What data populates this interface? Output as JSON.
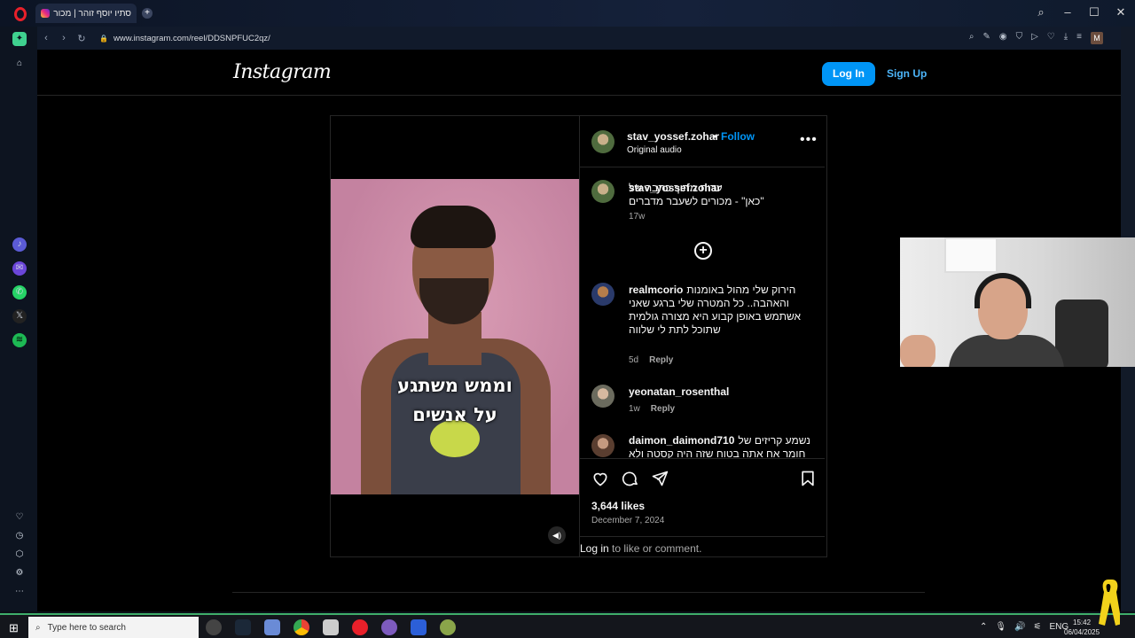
{
  "browser": {
    "tab_title": "סתיו יוסף זוהר | מכורים לשעבר מדברים",
    "url": "www.instagram.com/reel/DDSNPFUC2qz/",
    "profile_initial": "M"
  },
  "instagram": {
    "logo": "Instagram",
    "login_button": "Log In",
    "signup_link": "Sign Up"
  },
  "post": {
    "subtitle_line1": "וממש משתגע",
    "subtitle_line2": "על אנשים",
    "author": {
      "username": "stav_yossef.zohar",
      "follow_label": "Follow",
      "separator": "•",
      "audio": "Original audio"
    },
    "caption": {
      "username": "stav_yossef.zohar",
      "text": "עדות מתוך כתבה של \"כאן\" - מכורים לשעבר מדברים",
      "age": "17w"
    },
    "comments": [
      {
        "username": "realmcorio",
        "text": "הירוק שלי מהול באומנות והאהבה.. כל המטרה שלי ברגע שאני אשתמש באופן קבוע היא מצורה גולמית שתוכל לתת לי שלווה",
        "age": "5d",
        "reply": "Reply"
      },
      {
        "username": "yeonatan_rosenthal",
        "text": "",
        "age": "1w",
        "reply": "Reply"
      },
      {
        "username": "daimon_daimond710",
        "text": "נשמע קריזים של חומר אח אתה בטוח שזה היה קסטה ולא",
        "age": "",
        "reply": ""
      }
    ],
    "likes": "3,644 likes",
    "date": "December 7, 2024",
    "login_prompt_link": "Log in",
    "login_prompt_rest": " to like or comment."
  },
  "taskbar": {
    "search_placeholder": "Type here to search",
    "language": "ENG",
    "time": "15:42",
    "date": "06/04/2025"
  },
  "icons": {
    "like": "heart-icon",
    "comment": "comment-icon",
    "share": "paper-plane-icon",
    "save": "bookmark-icon",
    "sound": "speaker-icon",
    "add": "plus-circle-icon"
  },
  "colors": {
    "instagram_blue": "#0095f6",
    "link_blue": "#4cb5f9",
    "video_bg": "#c98aa6"
  }
}
